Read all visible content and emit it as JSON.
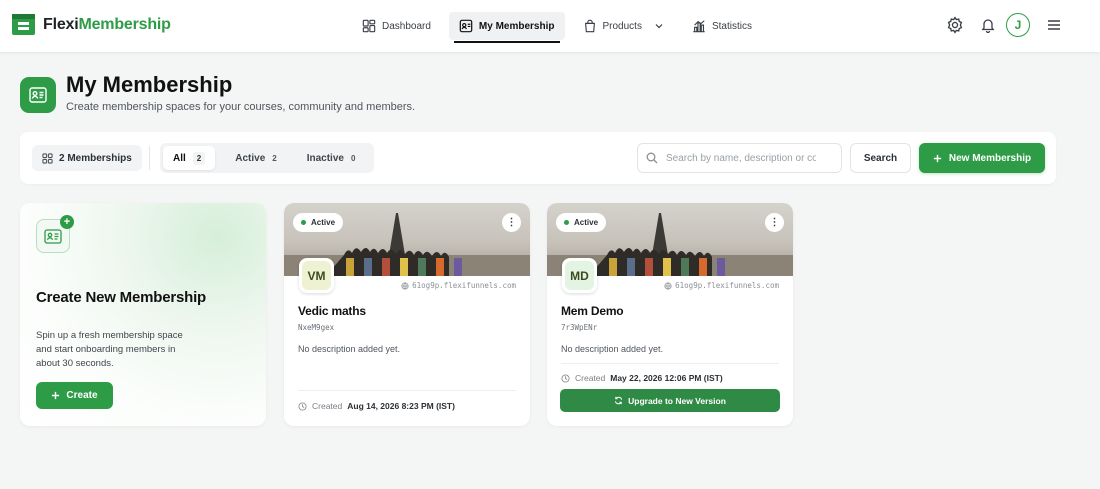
{
  "brand": {
    "part1": "Flexi",
    "part2": "Membership"
  },
  "nav": {
    "items": [
      {
        "label": "Dashboard"
      },
      {
        "label": "My Membership"
      },
      {
        "label": "Products"
      },
      {
        "label": "Statistics"
      }
    ]
  },
  "user": {
    "initial": "J"
  },
  "header": {
    "title": "My Membership",
    "subtitle": "Create membership spaces for your courses, community and members."
  },
  "toolbar": {
    "count_label": "2 Memberships",
    "filters": [
      {
        "label": "All",
        "count": "2"
      },
      {
        "label": "Active",
        "count": "2"
      },
      {
        "label": "Inactive",
        "count": "0"
      }
    ],
    "search_placeholder": "Search by name, description or code",
    "search_label": "Search",
    "new_label": "New Membership"
  },
  "create_card": {
    "title": "Create New Membership",
    "description": "Spin up a fresh membership space and start onboarding members in about 30 seconds.",
    "button_label": "Create"
  },
  "memberships": [
    {
      "status": "Active",
      "initials": "VM",
      "domain": "61og9p.flexifunnels.com",
      "name": "Vedic maths",
      "code": "NxeM9gex",
      "description": "No description added yet.",
      "created_label": "Created",
      "created_at": "Aug 14, 2026 8:23 PM (IST)"
    },
    {
      "status": "Active",
      "initials": "MD",
      "domain": "61og9p.flexifunnels.com",
      "name": "Mem Demo",
      "code": "7r3WpENr",
      "description": "No description added yet.",
      "created_label": "Created",
      "created_at": "May 22, 2026 12:06 PM (IST)",
      "upgrade_label": "Upgrade to New Version"
    }
  ],
  "colors": {
    "brand_green": "#2e9b47",
    "dark_green": "#2e8a44"
  }
}
